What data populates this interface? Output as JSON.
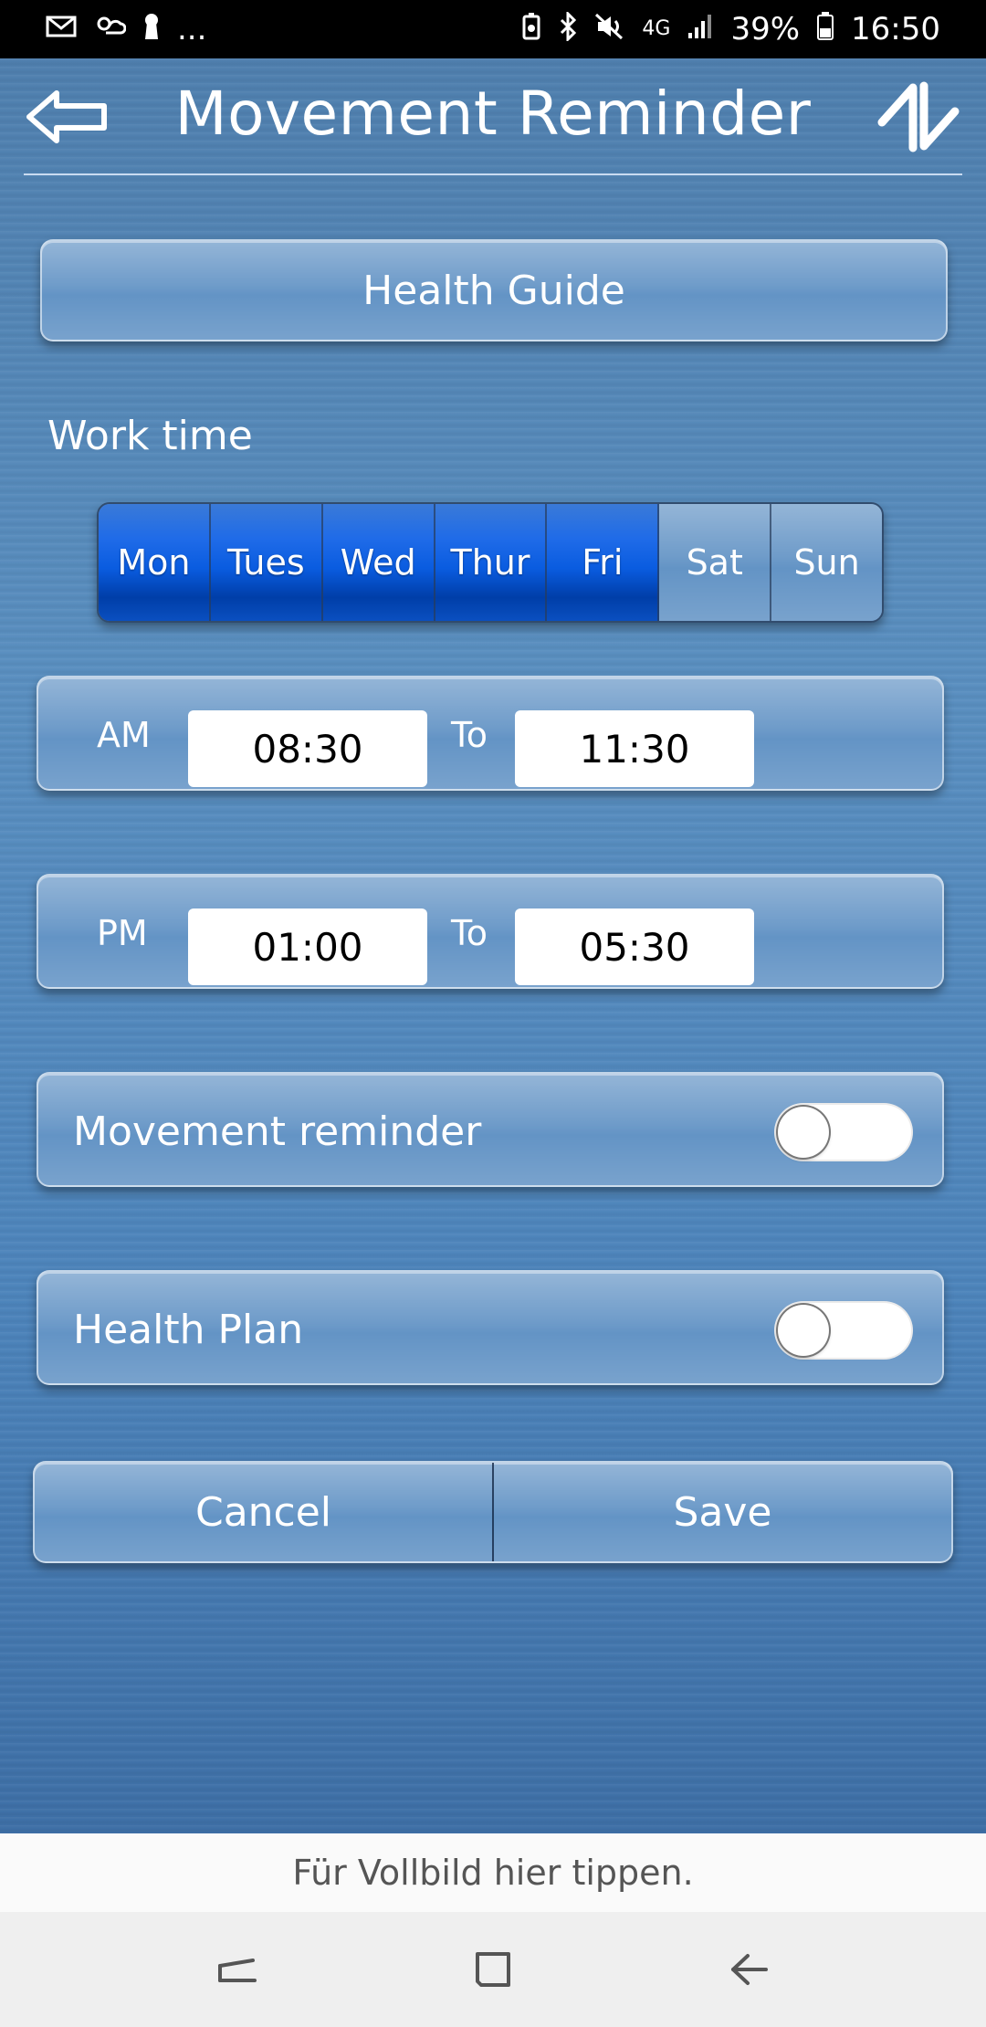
{
  "status_bar": {
    "icons_left": [
      "mail-icon",
      "weather-icon",
      "keyhole-icon"
    ],
    "overflow": "...",
    "icons_right": [
      "battery-saver-icon",
      "bluetooth-icon",
      "mute-icon",
      "network-4g-icon",
      "signal-icon",
      "battery-icon"
    ],
    "network": "4G",
    "battery": "39%",
    "time": "16:50"
  },
  "header": {
    "title": "Movement Reminder",
    "back_icon": "back-arrow-icon",
    "sync_icon": "sync-arrows-icon"
  },
  "health_guide": {
    "label": "Health Guide"
  },
  "work_time": {
    "label": "Work time",
    "days": [
      {
        "label": "Mon",
        "active": true
      },
      {
        "label": "Tues",
        "active": true
      },
      {
        "label": "Wed",
        "active": true
      },
      {
        "label": "Thur",
        "active": true
      },
      {
        "label": "Fri",
        "active": true
      },
      {
        "label": "Sat",
        "active": false
      },
      {
        "label": "Sun",
        "active": false
      }
    ]
  },
  "am": {
    "label": "AM",
    "start": "08:30",
    "to": "To",
    "end": "11:30"
  },
  "pm": {
    "label": "PM",
    "start": "01:00",
    "to": "To",
    "end": "05:30"
  },
  "movement_reminder": {
    "label": "Movement reminder",
    "enabled": false
  },
  "health_plan": {
    "label": "Health Plan",
    "enabled": false
  },
  "actions": {
    "cancel": "Cancel",
    "save": "Save"
  },
  "fullscreen_hint": "Für Vollbild hier tippen.",
  "nav": [
    "recent-apps-icon",
    "home-icon",
    "back-icon"
  ]
}
